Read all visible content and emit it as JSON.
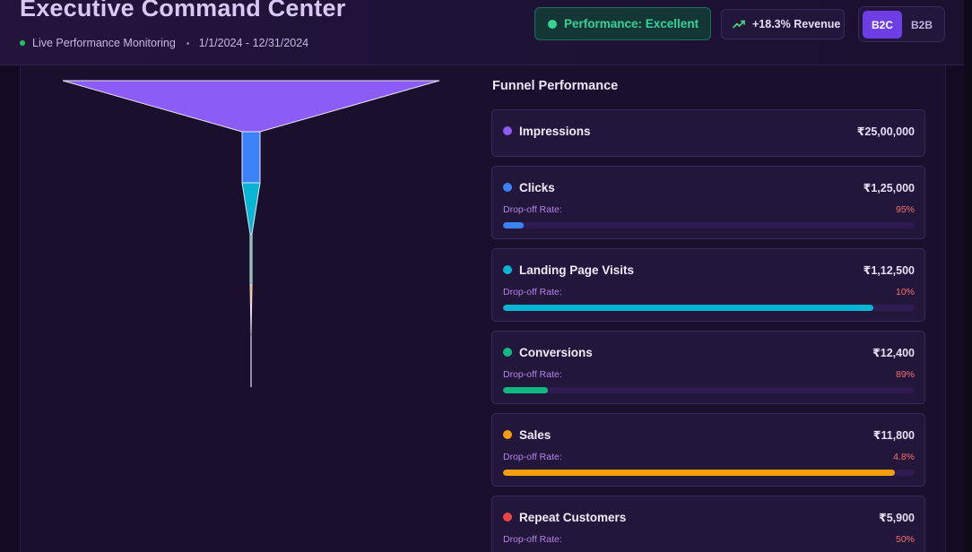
{
  "header": {
    "title": "Executive Command Center",
    "live_label": "Live Performance Monitoring",
    "date_range": "1/1/2024 - 12/31/2024",
    "performance_badge": "Performance: Excellent",
    "revenue_badge": "+18.3% Revenue",
    "segments": [
      "B2C",
      "B2B"
    ],
    "selected_segment": "B2C"
  },
  "funnel": {
    "title": "Funnel Performance",
    "drop_label": "Drop-off Rate:",
    "stages": [
      {
        "name": "Impressions",
        "value": "₹25,00,000",
        "drop": "",
        "fill": 0,
        "color": "#8b5cf6"
      },
      {
        "name": "Clicks",
        "value": "₹1,25,000",
        "drop": "95%",
        "fill": 0.05,
        "color": "#3b82f6"
      },
      {
        "name": "Landing Page Visits",
        "value": "₹1,12,500",
        "drop": "10%",
        "fill": 0.9,
        "color": "#06b6d4"
      },
      {
        "name": "Conversions",
        "value": "₹12,400",
        "drop": "89%",
        "fill": 0.11,
        "color": "#10b981"
      },
      {
        "name": "Sales",
        "value": "₹11,800",
        "drop": "4.8%",
        "fill": 0.952,
        "color": "#f59e0b"
      },
      {
        "name": "Repeat Customers",
        "value": "₹5,900",
        "drop": "50%",
        "fill": 0.5,
        "color": "#ef4444"
      }
    ]
  },
  "colors": {
    "accent": "#6d3ee6",
    "success": "#34d399",
    "danger": "#f87171",
    "background": "#140b22"
  }
}
